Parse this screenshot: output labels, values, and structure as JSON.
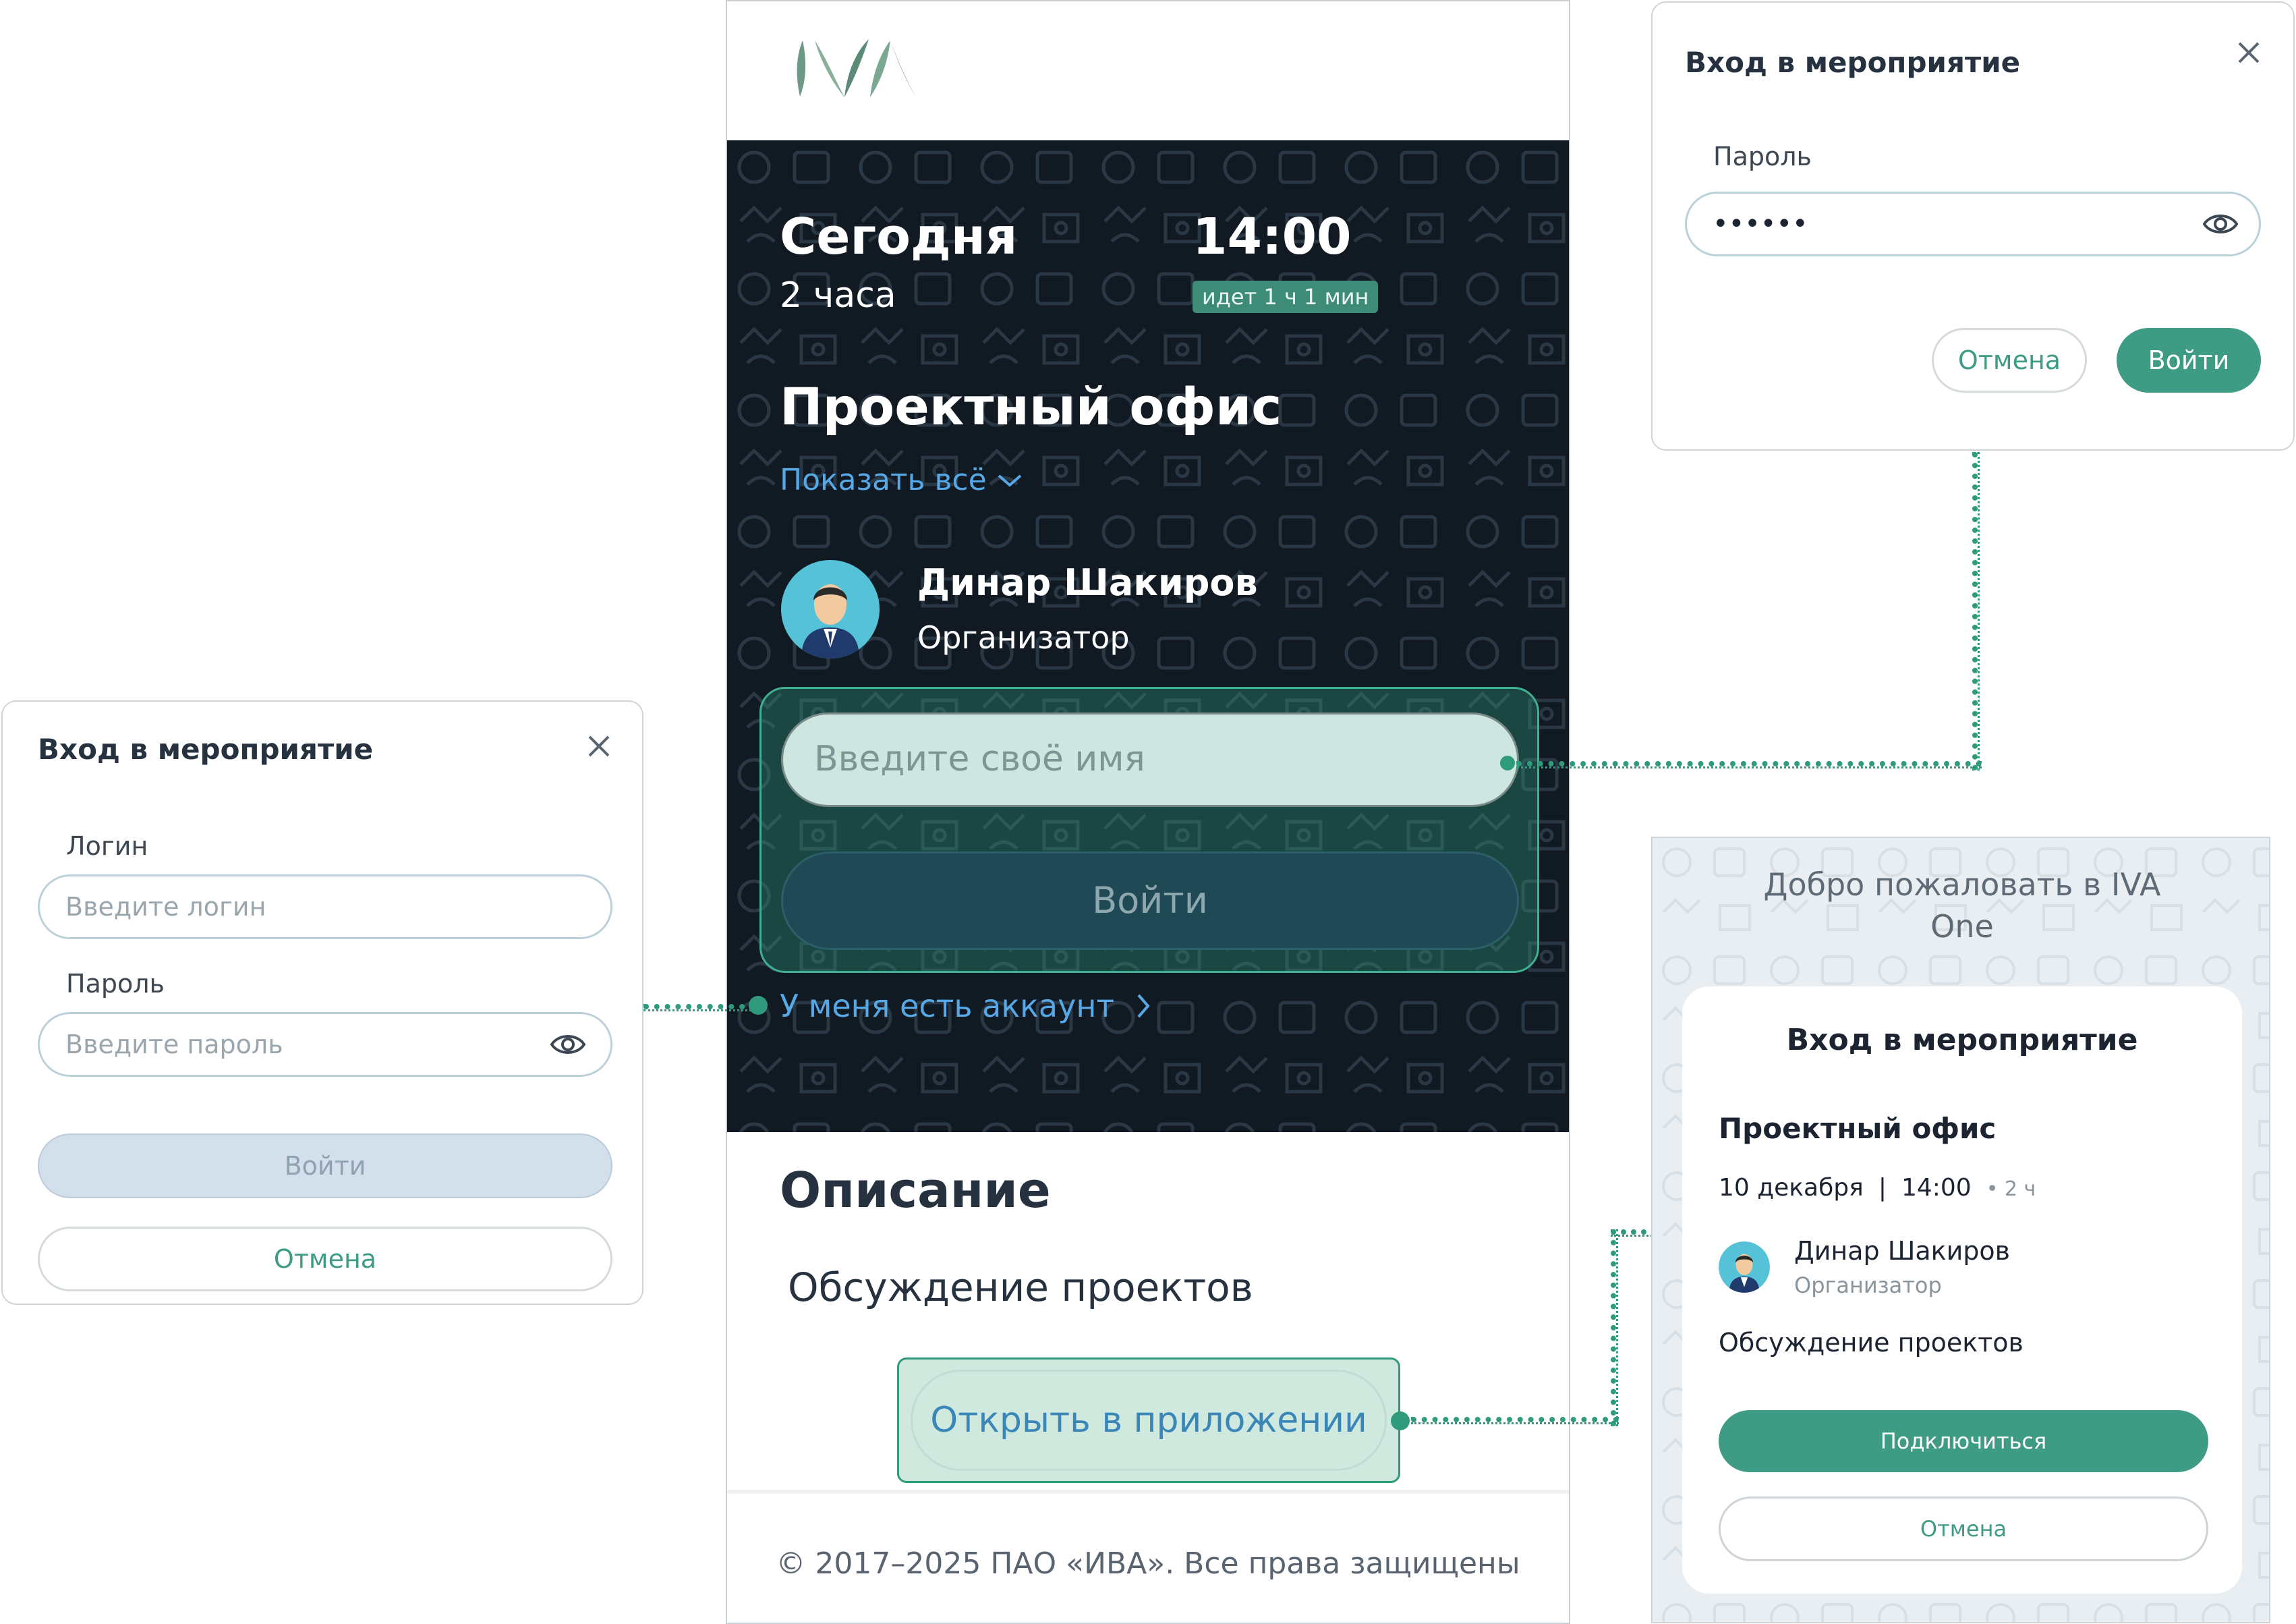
{
  "brand": {
    "logo_text": "IVA",
    "accent": "#3e9b84",
    "link_color": "#56a8e6",
    "hero_bg": "#111a22"
  },
  "event": {
    "day": "Сегодня",
    "duration": "2 часа",
    "time": "14:00",
    "status_badge": "идет 1 ч 1 мин",
    "title": "Проектный офис",
    "show_all": "Показать всё",
    "organizer_name": "Динар Шакиров",
    "organizer_role": "Организатор"
  },
  "join_form": {
    "name_placeholder": "Введите своё имя",
    "login_button": "Войти",
    "have_account_link": "У меня есть аккаунт"
  },
  "description": {
    "heading": "Описание",
    "text": "Обсуждение проектов",
    "open_app_button": "Открыть в приложении"
  },
  "footer": {
    "copyright": "© 2017–2025 ПАО «ИВА». Все права защищены"
  },
  "password_dialog": {
    "title": "Вход в мероприятие",
    "password_label": "Пароль",
    "password_value": "••••••",
    "cancel": "Отмена",
    "submit": "Войти",
    "icons": [
      "close-icon",
      "eye-icon"
    ]
  },
  "account_dialog": {
    "title": "Вход в мероприятие",
    "login_label": "Логин",
    "login_placeholder": "Введите логин",
    "password_label": "Пароль",
    "password_placeholder": "Введите пароль",
    "submit": "Войти",
    "cancel": "Отмена",
    "icons": [
      "close-icon",
      "eye-icon"
    ]
  },
  "app_welcome": {
    "welcome": "Добро пожаловать в IVA One",
    "card_title": "Вход в мероприятие",
    "event_title": "Проектный офис",
    "date": "10 декабря",
    "separator": "|",
    "time": "14:00",
    "duration": "• 2 ч",
    "organizer_name": "Динар Шакиров",
    "organizer_role": "Организатор",
    "description": "Обсуждение проектов",
    "connect": "Подключиться",
    "cancel": "Отмена"
  }
}
